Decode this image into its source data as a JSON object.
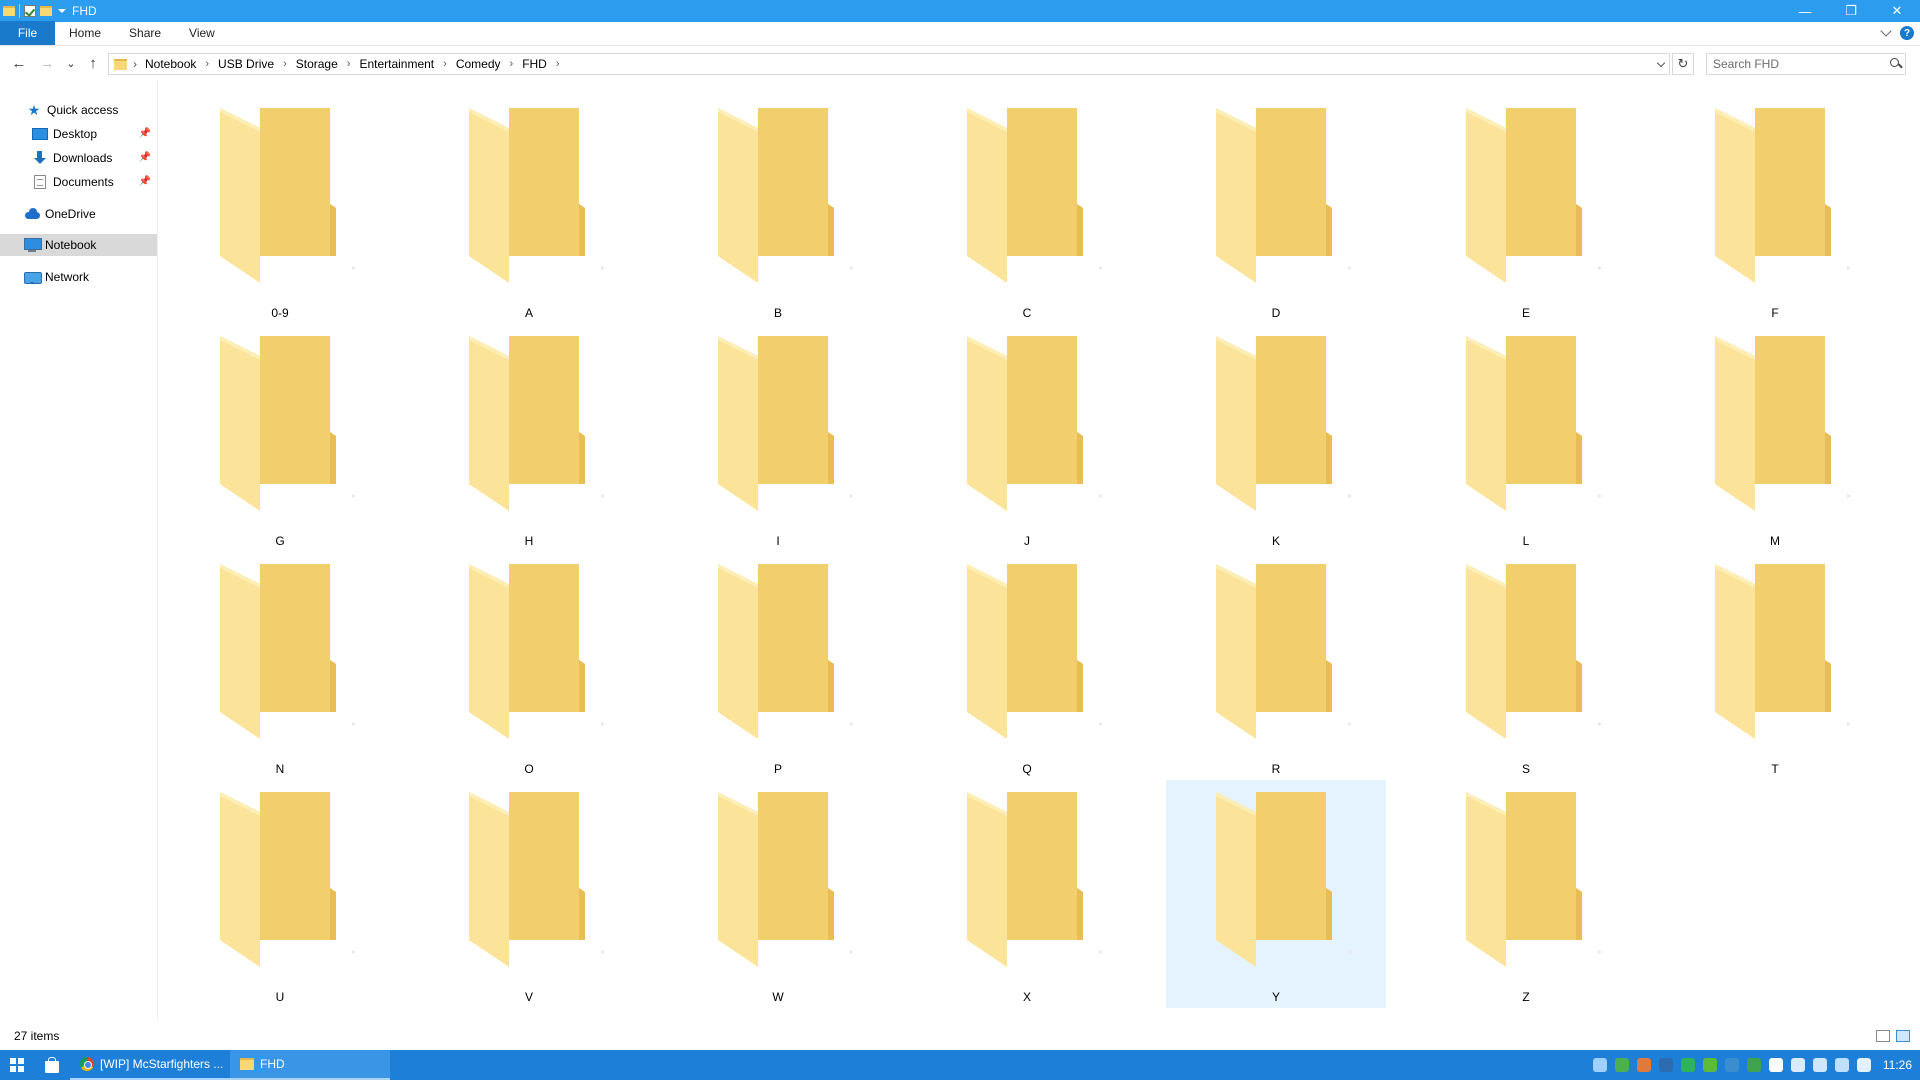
{
  "window": {
    "title": "FHD",
    "controls": {
      "minimize": "—",
      "restore": "❐",
      "close": "✕"
    }
  },
  "ribbon": {
    "tabs": [
      "File",
      "Home",
      "Share",
      "View"
    ],
    "help": "?"
  },
  "address": {
    "breadcrumb": [
      "Notebook",
      "USB Drive",
      "Storage",
      "Entertainment",
      "Comedy",
      "FHD"
    ],
    "separator": "›"
  },
  "search": {
    "placeholder": "Search FHD",
    "value": ""
  },
  "nav": {
    "back": "←",
    "forward": "→",
    "recent": "⌄",
    "up": "↑",
    "refresh": "↻",
    "pin": "📌",
    "items": [
      {
        "label": "Quick access",
        "icon": "star-icon"
      },
      {
        "label": "Desktop",
        "icon": "desktop-icon",
        "pinned": true
      },
      {
        "label": "Downloads",
        "icon": "download-icon",
        "pinned": true
      },
      {
        "label": "Documents",
        "icon": "documents-icon",
        "pinned": true
      },
      {
        "label": "OneDrive",
        "icon": "cloud-icon"
      },
      {
        "label": "Notebook",
        "icon": "computer-icon",
        "selected": true
      },
      {
        "label": "Network",
        "icon": "network-icon"
      }
    ]
  },
  "folders": [
    "0-9",
    "A",
    "B",
    "C",
    "D",
    "E",
    "F",
    "G",
    "H",
    "I",
    "J",
    "K",
    "L",
    "M",
    "N",
    "O",
    "P",
    "Q",
    "R",
    "S",
    "T",
    "U",
    "V",
    "W",
    "X",
    "Y",
    "Z"
  ],
  "selected_folder": "Y",
  "status": {
    "item_count": "27 items"
  },
  "taskbar": {
    "apps": [
      {
        "label": "[WIP] McStarfighters ...",
        "icon": "chrome-icon"
      },
      {
        "label": "FHD",
        "icon": "folder-icon",
        "active": true
      }
    ],
    "clock": "11:26",
    "colors": {
      "taskbar": "#1e7fd8",
      "titlebar": "#2b9cee",
      "selection": "#e5f3ff"
    }
  }
}
